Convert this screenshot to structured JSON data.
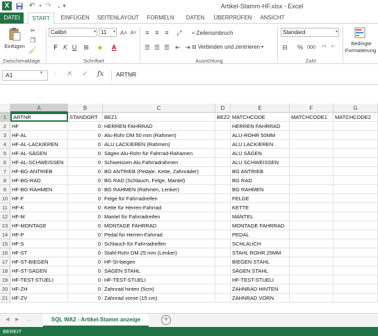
{
  "window": {
    "title": "Artikel-Stamm-HF.xlsx - Excel",
    "logo": "X"
  },
  "tabs": [
    "DATEI",
    "START",
    "EINFÜGEN",
    "SEITENLAYOUT",
    "FORMELN",
    "DATEN",
    "ÜBERPRÜFEN",
    "ANSICHT"
  ],
  "active_tab": "START",
  "ribbon": {
    "paste_label": "Einfügen",
    "font_name": "Calibri",
    "font_size": "11",
    "bold": "F",
    "italic": "K",
    "underline": "U",
    "wrap_text": "Zeilenumbruch",
    "merge_center": "Verbinden und zentrieren",
    "number_format": "Standard",
    "percent": "%",
    "thousands": "000",
    "conditional": "Bedingte",
    "conditional2": "Formatierung",
    "groups": {
      "clipboard": "Zwischenablage",
      "font": "Schriftart",
      "alignment": "Ausrichtung",
      "number": "Zahl"
    },
    "accent_color": "#217346"
  },
  "formula_bar": {
    "name_box": "A1",
    "cancel": "✕",
    "confirm": "✓",
    "fx": "fx",
    "content": "ARTNR"
  },
  "columns": [
    "A",
    "B",
    "C",
    "D",
    "E",
    "F",
    "G"
  ],
  "header_row": [
    "ARTNR",
    "STANDORT",
    "BEZ1",
    "BEZ2",
    "MATCHCODE",
    "MATCHCODE1",
    "MATCHCODE2"
  ],
  "rows": [
    [
      "HF",
      "0",
      "HERREN FAHRRAD",
      "",
      "HERREN FAHRRAD",
      "",
      ""
    ],
    [
      "HF-AL",
      "0",
      "Alu-Rohr DM 50 mm (Rahmen)",
      "",
      "ALU-ROHR 50MM",
      "",
      ""
    ],
    [
      "HF-AL-LACKIEREN",
      "0",
      "ALU LACKIEREN (Rahmen)",
      "",
      "ALU LACKIEREN",
      "",
      ""
    ],
    [
      "HF-AL-SÄGEN",
      "0",
      "Sägen Alu-Rohr für Fahrrad-Rahamen",
      "",
      "ALU SÄGEN",
      "",
      ""
    ],
    [
      "HF-AL-SCHWEISSEN",
      "0",
      "Schweissen Alu Fahrradrahmen",
      "",
      "ALU SCHWEISSEN",
      "",
      ""
    ],
    [
      "HF-BG-ANTRIEB",
      "0",
      "BG ANTRIEB (Pedale, Kette, Zahnräder)",
      "",
      "BG ANTRIEB",
      "",
      ""
    ],
    [
      "HF-BG-RAD",
      "0",
      "BG RAD (Schlauch, Felge, Mantel)",
      "",
      "BG RAD",
      "",
      ""
    ],
    [
      "HF-BG-RAHMEN",
      "0",
      "BG RAHMEN (Rahmen, Lenker)",
      "",
      "BG RAHMEN",
      "",
      ""
    ],
    [
      "HF-F",
      "0",
      "Felge für Fahrradreifen",
      "",
      "FELGE",
      "",
      ""
    ],
    [
      "HF-K",
      "0",
      "Kette für Herren-Fahrrad",
      "",
      "KETTE",
      "",
      ""
    ],
    [
      "HF-M",
      "0",
      "Mantel für Fahrradreifen",
      "",
      "MANTEL",
      "",
      ""
    ],
    [
      "HF-MONTAGE",
      "0",
      "MONTAGE FAHRRAD",
      "",
      "MONTAGE FAHRRAD",
      "",
      ""
    ],
    [
      "HF-P",
      "0",
      "Pedal für Herren-Fahrrad",
      "",
      "PEDAL",
      "",
      ""
    ],
    [
      "HF-S",
      "0",
      "Schlauch für Fahrradreifen",
      "",
      "SCHLAUCH",
      "",
      ""
    ],
    [
      "HF-ST",
      "0",
      "Stahl-Rohr DM 25 mm (Lenker)",
      "",
      "STAHL ROHR 25MM",
      "",
      ""
    ],
    [
      "HF-ST-BIEGEN",
      "0",
      "HF-St-biegen",
      "",
      "BIEGEN STAHL",
      "",
      ""
    ],
    [
      "HF-ST-SÄGEN",
      "0",
      "SÄGEN STAHL",
      "",
      "SÄGEN STAHL",
      "",
      ""
    ],
    [
      "HF-TEST-STUELI",
      "0",
      "HF-TEST-STUELI",
      "",
      "HF-TEST-STUELI",
      "",
      ""
    ],
    [
      "HF-ZH",
      "0",
      "Zahnrad hinten (5cm)",
      "",
      "ZAHNRAD HINTEN",
      "",
      ""
    ],
    [
      "HF-ZV",
      "0",
      "Zahnrad vorne (15 cm)",
      "",
      "ZAHNRAD VORN",
      "",
      ""
    ]
  ],
  "sheet_tab": "SQL WA2 - Artikel-Stamm anzeige",
  "add_sheet": "+",
  "status": "BEREIT"
}
